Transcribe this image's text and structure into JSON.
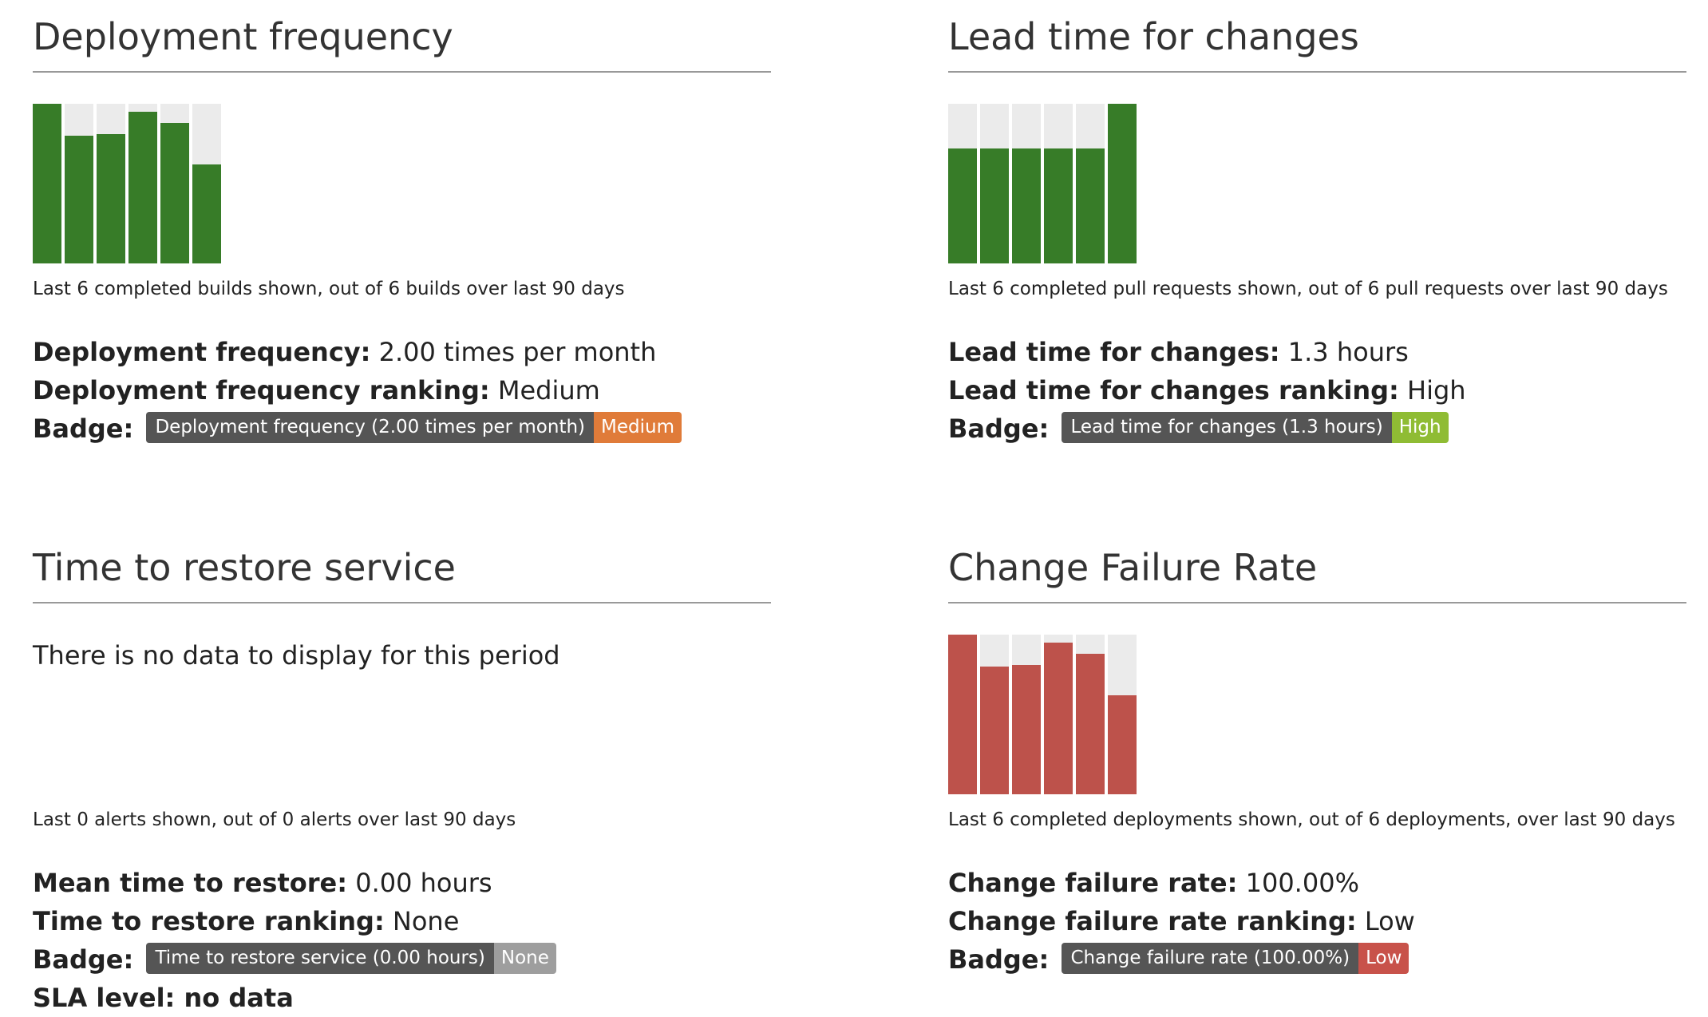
{
  "deployment": {
    "title": "Deployment frequency",
    "bars": [
      1.0,
      0.8,
      0.81,
      0.95,
      0.88,
      0.62
    ],
    "caption": "Last 6 completed builds shown, out of 6 builds over last 90 days",
    "metric_label": "Deployment frequency:",
    "metric_value": "2.00 times per month",
    "ranking_label": "Deployment frequency ranking:",
    "ranking_value": "Medium",
    "badge_label": "Badge:",
    "badge_left": "Deployment frequency (2.00 times per month)",
    "badge_right": "Medium",
    "badge_color": "#e07b39",
    "bar_color": "#377c28"
  },
  "leadtime": {
    "title": "Lead time for changes",
    "bars": [
      0.72,
      0.72,
      0.72,
      0.72,
      0.72,
      1.0
    ],
    "caption": "Last 6 completed pull requests shown, out of 6 pull requests over last 90 days",
    "metric_label": "Lead time for changes:",
    "metric_value": "1.3 hours",
    "ranking_label": "Lead time for changes ranking:",
    "ranking_value": "High",
    "badge_label": "Badge:",
    "badge_left": "Lead time for changes (1.3 hours)",
    "badge_right": "High",
    "badge_color": "#8fbc34",
    "bar_color": "#377c28"
  },
  "restore": {
    "title": "Time to restore service",
    "no_data": "There is no data to display for this period",
    "caption": "Last 0 alerts shown, out of 0 alerts over last 90 days",
    "metric_label": "Mean time to restore:",
    "metric_value": "0.00 hours",
    "ranking_label": "Time to restore ranking:",
    "ranking_value": "None",
    "badge_label": "Badge:",
    "badge_left": "Time to restore service (0.00 hours)",
    "badge_right": "None",
    "badge_color": "#9e9e9e",
    "sla_label": "SLA level: no data"
  },
  "failure": {
    "title": "Change Failure Rate",
    "bars": [
      1.0,
      0.8,
      0.81,
      0.95,
      0.88,
      0.62
    ],
    "caption": "Last 6 completed deployments shown, out of 6 deployments, over last 90 days",
    "metric_label": "Change failure rate:",
    "metric_value": "100.00%",
    "ranking_label": "Change failure rate ranking:",
    "ranking_value": "Low",
    "badge_label": "Badge:",
    "badge_left": "Change failure rate (100.00%)",
    "badge_right": "Low",
    "badge_color": "#c8524a",
    "bar_color": "#bd524b"
  }
}
